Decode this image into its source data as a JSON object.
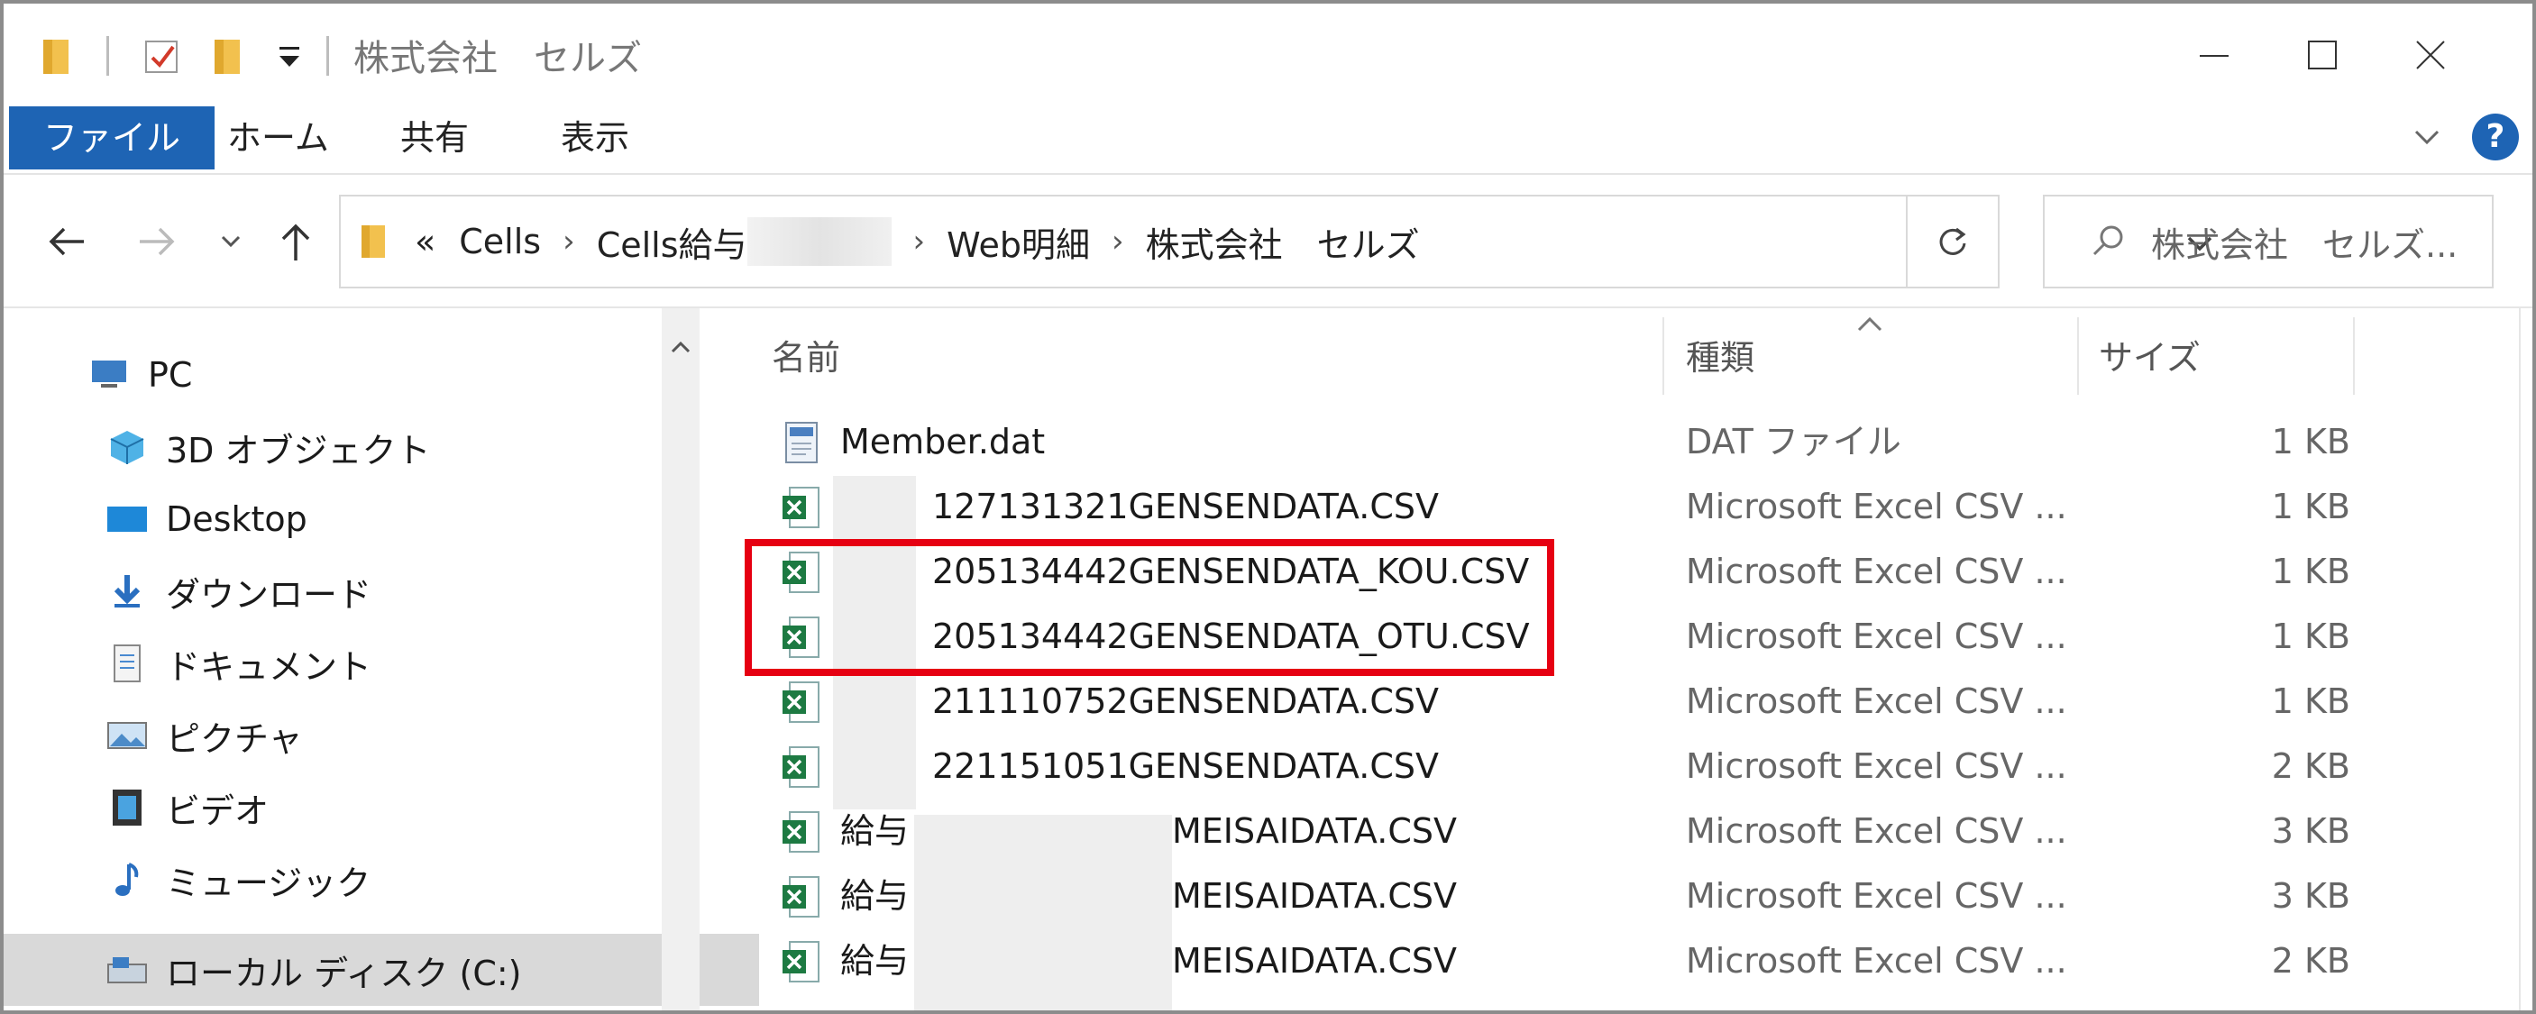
{
  "window": {
    "title": "株式会社　セルズ",
    "controls": [
      "minimize-icon",
      "maximize-icon",
      "close-icon"
    ]
  },
  "ribbon": {
    "tabs": [
      {
        "label": "ファイル",
        "active": true
      },
      {
        "label": "ホーム"
      },
      {
        "label": "共有"
      },
      {
        "label": "表示"
      }
    ],
    "help_label": "?"
  },
  "address": {
    "prefix": "«",
    "crumbs": [
      "Cells",
      "Cells給与",
      "Web明細",
      "株式会社　セルズ"
    ]
  },
  "search": {
    "placeholder": "株式会社　セルズ..."
  },
  "nav_pane": {
    "items": [
      {
        "label": "PC",
        "icon": "pc-icon"
      },
      {
        "label": "3D オブジェクト",
        "icon": "3d-objects-icon"
      },
      {
        "label": "Desktop",
        "icon": "desktop-icon"
      },
      {
        "label": "ダウンロード",
        "icon": "download-icon"
      },
      {
        "label": "ドキュメント",
        "icon": "document-icon"
      },
      {
        "label": "ピクチャ",
        "icon": "pictures-icon"
      },
      {
        "label": "ビデオ",
        "icon": "video-icon"
      },
      {
        "label": "ミュージック",
        "icon": "music-icon"
      },
      {
        "label": "ローカル ディスク (C:)",
        "icon": "local-disk-icon",
        "selected": true
      }
    ]
  },
  "file_list": {
    "columns": {
      "name": "名前",
      "type": "種類",
      "size": "サイズ"
    },
    "rows": [
      {
        "name": "Member.dat",
        "type": "DAT ファイル",
        "size": "1 KB",
        "icon": "dat-file-icon"
      },
      {
        "name": "127131321GENSENDATA.CSV",
        "type": "Microsoft Excel CSV ...",
        "size": "1 KB",
        "icon": "excel-csv-icon"
      },
      {
        "name": "205134442GENSENDATA_KOU.CSV",
        "type": "Microsoft Excel CSV ...",
        "size": "1 KB",
        "icon": "excel-csv-icon"
      },
      {
        "name": "205134442GENSENDATA_OTU.CSV",
        "type": "Microsoft Excel CSV ...",
        "size": "1 KB",
        "icon": "excel-csv-icon"
      },
      {
        "name": "211110752GENSENDATA.CSV",
        "type": "Microsoft Excel CSV ...",
        "size": "1 KB",
        "icon": "excel-csv-icon"
      },
      {
        "name": "221151051GENSENDATA.CSV",
        "type": "Microsoft Excel CSV ...",
        "size": "2 KB",
        "icon": "excel-csv-icon"
      },
      {
        "name": "給与",
        "name_suffix": "MEISAIDATA.CSV",
        "type": "Microsoft Excel CSV ...",
        "size": "3 KB",
        "icon": "excel-csv-icon"
      },
      {
        "name": "給与",
        "name_suffix": "MEISAIDATA.CSV",
        "type": "Microsoft Excel CSV ...",
        "size": "3 KB",
        "icon": "excel-csv-icon"
      },
      {
        "name": "給与",
        "name_suffix": "MEISAIDATA.CSV",
        "type": "Microsoft Excel CSV ...",
        "size": "2 KB",
        "icon": "excel-csv-icon"
      }
    ]
  },
  "colors": {
    "accent": "#1e64b4",
    "highlight": "#e60012",
    "excel_green": "#1d7a42",
    "folder_yellow": "#f2c14e"
  }
}
